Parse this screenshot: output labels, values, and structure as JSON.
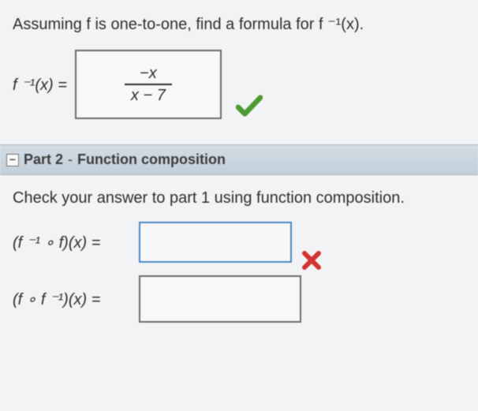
{
  "q1_text": "Assuming f is one-to-one, find a formula for  f ⁻¹(x).",
  "lhs1": "f ⁻¹(x)  =",
  "answer1": {
    "num": "−x",
    "den": "x − 7"
  },
  "part2": {
    "label": "Part 2",
    "dash": " - ",
    "title": "Function composition"
  },
  "q2_text": "Check your answer to part 1 using function composition.",
  "lhs2a": "(f ⁻¹ ∘ f)(x)  =",
  "lhs2b": "(f ∘ f ⁻¹)(x)  =",
  "ans2a": "",
  "ans2b": ""
}
